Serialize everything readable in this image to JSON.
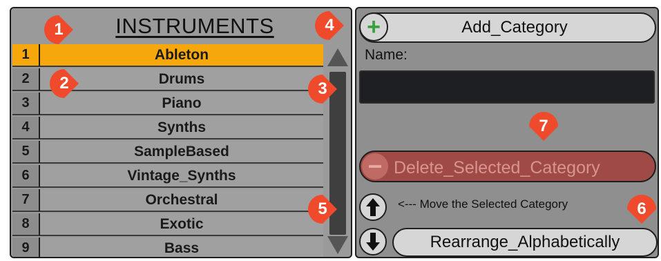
{
  "instruments_panel": {
    "title": "INSTRUMENTS",
    "selected_index": 0,
    "items": [
      {
        "number": "1",
        "name": "Ableton"
      },
      {
        "number": "2",
        "name": "Drums"
      },
      {
        "number": "3",
        "name": "Piano"
      },
      {
        "number": "4",
        "name": "Synths"
      },
      {
        "number": "5",
        "name": "SampleBased"
      },
      {
        "number": "6",
        "name": "Vintage_Synths"
      },
      {
        "number": "7",
        "name": "Orchestral"
      },
      {
        "number": "8",
        "name": "Exotic"
      },
      {
        "number": "9",
        "name": "Bass"
      }
    ]
  },
  "category_panel": {
    "add_label": "Add_Category",
    "name_label": "Name:",
    "name_value": "",
    "delete_label": "Delete_Selected_Category",
    "move_label": "<--- Move the Selected Category",
    "rearrange_label": "Rearrange_Alphabetically"
  },
  "callouts": [
    "1",
    "2",
    "3",
    "4",
    "5",
    "6",
    "7"
  ],
  "colors": {
    "selected_row": "#f5a70c",
    "callout": "#ef4a2b",
    "add_icon": "#3aa03a",
    "delete_button": "#a04a48"
  }
}
